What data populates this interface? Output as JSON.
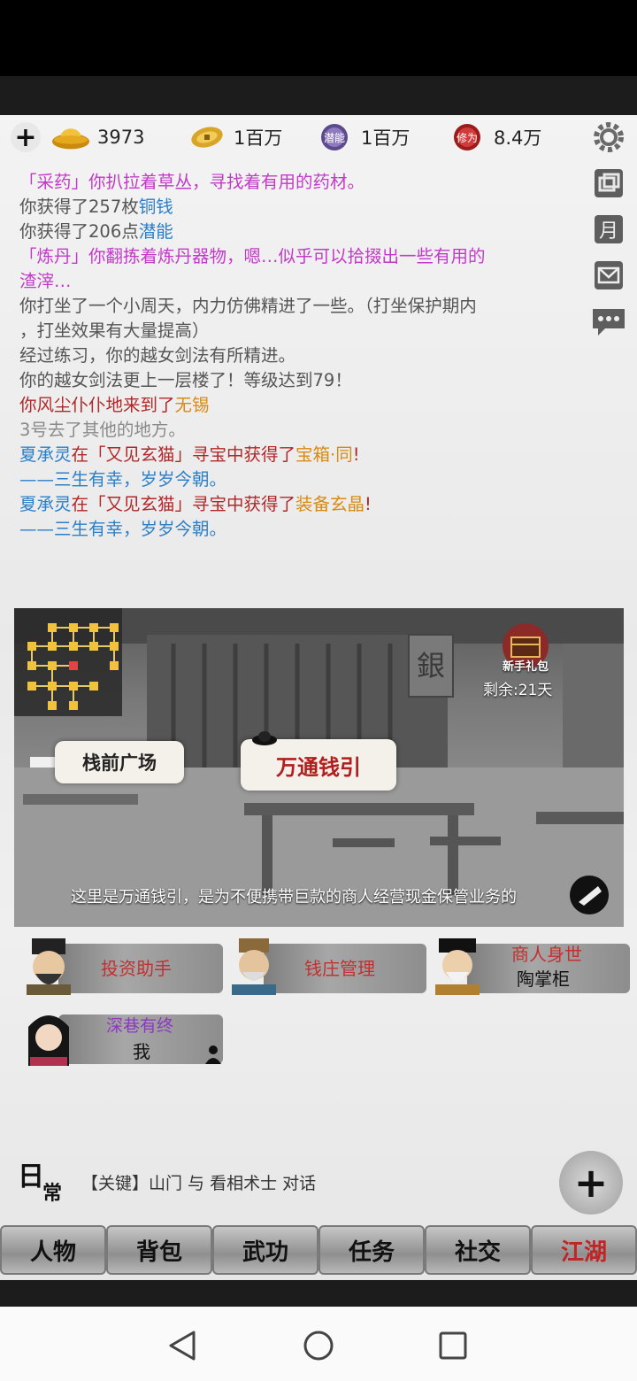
{
  "resources": [
    {
      "icon": "gold-ingot-icon",
      "value": "3973"
    },
    {
      "icon": "copper-coin-icon",
      "value": "1百万"
    },
    {
      "icon": "potential-icon",
      "value": "1百万",
      "icon_text": "潜能"
    },
    {
      "icon": "cultivation-icon",
      "value": "8.4万",
      "icon_text": "修为"
    }
  ],
  "log": {
    "l1a": "「采药」你扒拉着草丛，寻找着有用的药材。",
    "l2a": "你获得了257枚",
    "l2b": "铜钱",
    "l3a": "你获得了206点",
    "l3b": "潜能",
    "l4a": "「炼丹」你翻拣着炼丹器物，嗯…似乎可以拾掇出一些有用的",
    "l4b": "渣滓…",
    "l5a": "你打坐了一个小周天，内力仿佛精进了一些。（打坐保护期内",
    "l5b": "，打坐效果有大量提高）",
    "l6": "经过练习，你的越女剑法有所精进。",
    "l7": "你的越女剑法更上一层楼了！等级达到79！",
    "l8a": "你风尘仆仆地来到了",
    "l8b": "无锡",
    "l9": "3号去了其他的地方。",
    "l10a": "夏承灵",
    "l10b": "在「又见玄猫」寻宝中获得了",
    "l10c": "宝箱·同",
    "l10d": "!",
    "l11": "——三生有幸，岁岁今朝。",
    "l12a": "夏承灵",
    "l12b": "在「又见玄猫」寻宝中获得了",
    "l12c": "装备玄晶",
    "l12d": "!",
    "l13": "——三生有幸，岁岁今朝。"
  },
  "scene": {
    "location_prev": "栈前广场",
    "location_current": "万通钱引",
    "description": "这里是万通钱引，是为不便携带巨款的商人经营现金保管业务的",
    "gift_label": "新手礼包",
    "remaining": "剩余:21天",
    "sign_char": "銀"
  },
  "npcs": [
    {
      "label": "投资助手"
    },
    {
      "label": "钱庄管理"
    },
    {
      "title": "商人身世",
      "name": "陶掌柜"
    },
    {
      "title": "深巷有终",
      "name": "我"
    }
  ],
  "daily": {
    "label1": "日",
    "label2": "常",
    "hint": "【关键】山门 与 看相术士 对话"
  },
  "tabs": [
    "人物",
    "背包",
    "武功",
    "任务",
    "社交",
    "江湖"
  ],
  "side_buttons": [
    "gear-icon",
    "window-icon",
    "month-icon",
    "mail-icon",
    "chat-icon"
  ],
  "side_labels": {
    "month": "月"
  },
  "colors": {
    "pink": "#c23ac8",
    "blue": "#2b7fc8",
    "red": "#b02828",
    "orange": "#d98a12"
  }
}
